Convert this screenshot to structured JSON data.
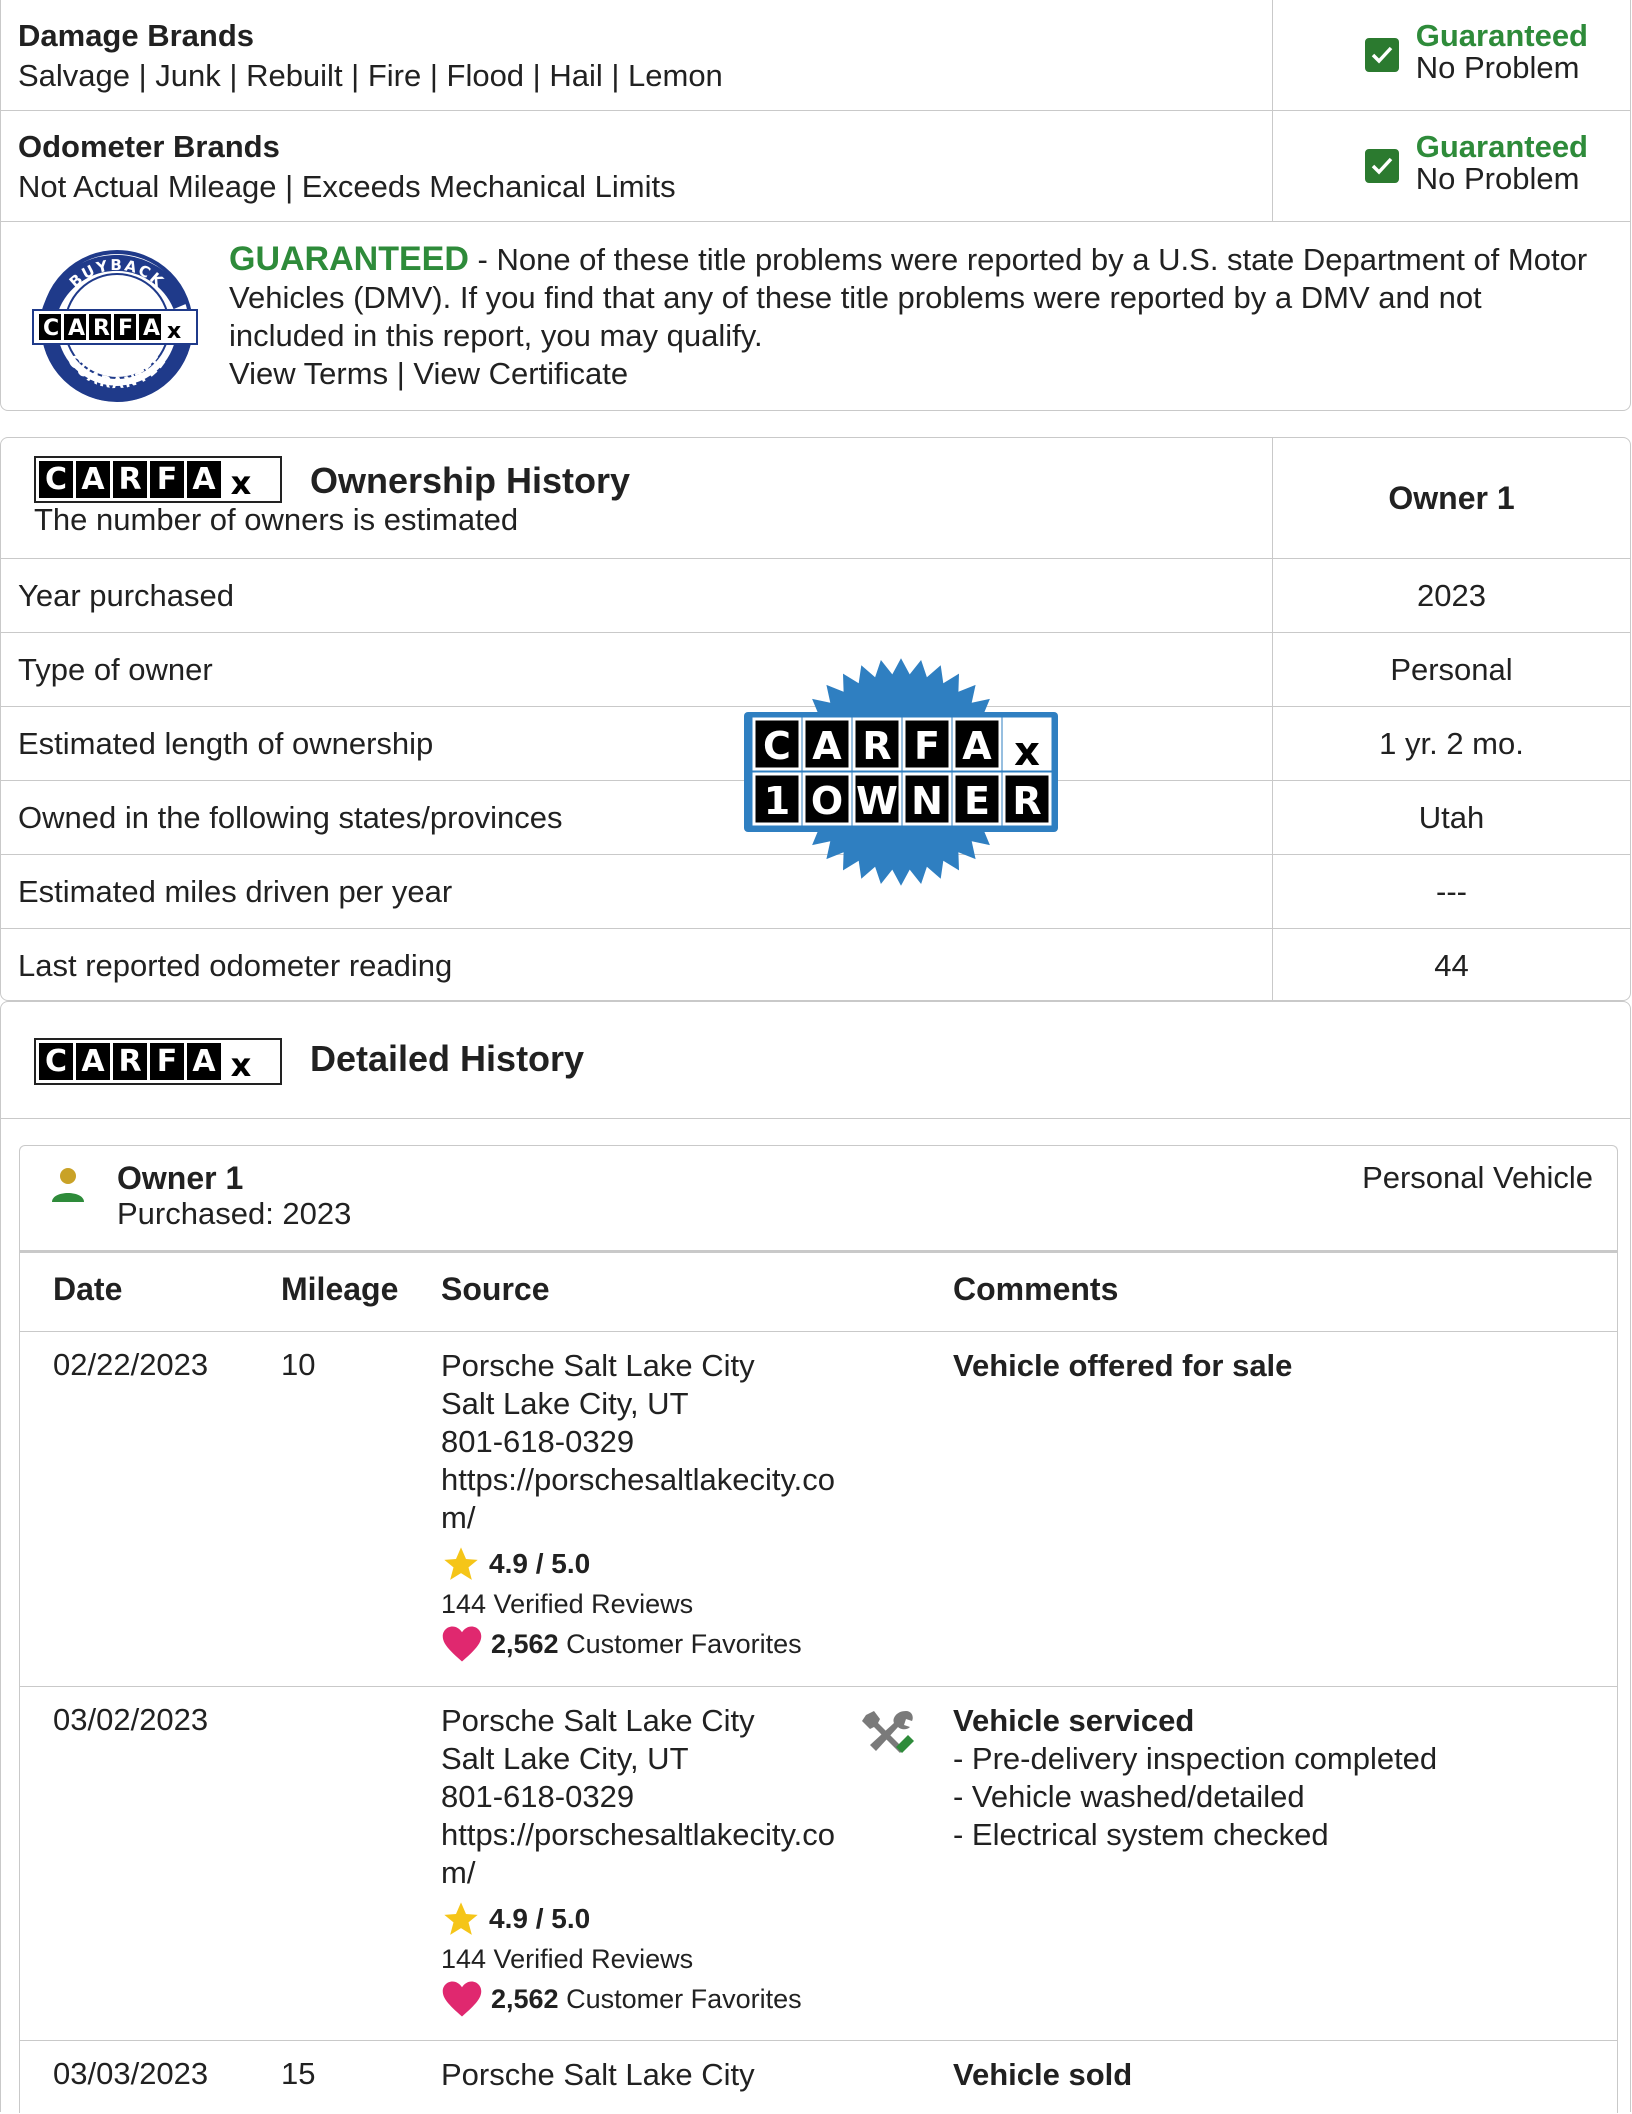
{
  "brands": {
    "rows": [
      {
        "title": "Damage Brands",
        "subtitle": "Salvage | Junk | Rebuilt | Fire | Flood | Hail | Lemon",
        "status_guaranteed": "Guaranteed",
        "status_result": "No Problem"
      },
      {
        "title": "Odometer Brands",
        "subtitle": "Not Actual Mileage | Exceeds Mechanical Limits",
        "status_guaranteed": "Guaranteed",
        "status_result": "No Problem"
      }
    ],
    "guarantee": {
      "word": "GUARANTEED",
      "text": " - None of these title problems were reported by a U.S. state Department of Motor Vehicles (DMV). If you find that any of these title problems were reported by a DMV and not included in this report, you may qualify.",
      "view_terms": "View Terms",
      "divider": " | ",
      "view_certificate": "View Certificate",
      "badge_top": "BUYBACK",
      "badge_bottom": "GUARANTEE"
    }
  },
  "logo_letters": [
    "C",
    "A",
    "R",
    "F",
    "A",
    "x"
  ],
  "ownership": {
    "title": "Ownership History",
    "subtitle": "The number of owners is estimated",
    "owner_header": "Owner 1",
    "rows": [
      {
        "label": "Year purchased",
        "value": "2023"
      },
      {
        "label": "Type of owner",
        "value": "Personal"
      },
      {
        "label": "Estimated length of ownership",
        "value": "1 yr. 2 mo."
      },
      {
        "label": "Owned in the following states/provinces",
        "value": "Utah"
      },
      {
        "label": "Estimated miles driven per year",
        "value": "---"
      },
      {
        "label": "Last reported odometer reading",
        "value": "44"
      }
    ],
    "seal_bottom_letters": [
      "1",
      "O",
      "W",
      "N",
      "E",
      "R"
    ]
  },
  "detailed": {
    "title": "Detailed History",
    "owner": {
      "name": "Owner 1",
      "purchased": "Purchased: 2023",
      "type": "Personal Vehicle"
    },
    "columns": {
      "date": "Date",
      "mileage": "Mileage",
      "source": "Source",
      "comments": "Comments"
    },
    "records": [
      {
        "date": "02/22/2023",
        "mileage": "10",
        "source_name": "Porsche Salt Lake City",
        "source_city": "Salt Lake City, UT",
        "source_phone": "801-618-0329",
        "source_url": "https://porschesaltlakecity.com/",
        "rating": "4.9 / 5.0",
        "reviews": "144 Verified Reviews",
        "favorites_count": "2,562",
        "favorites_label": "Customer Favorites",
        "comment_title": "Vehicle offered for sale",
        "comment_lines": []
      },
      {
        "date": "03/02/2023",
        "mileage": "",
        "source_name": "Porsche Salt Lake City",
        "source_city": "Salt Lake City, UT",
        "source_phone": "801-618-0329",
        "source_url": "https://porschesaltlakecity.com/",
        "rating": "4.9 / 5.0",
        "reviews": "144 Verified Reviews",
        "favorites_count": "2,562",
        "favorites_label": "Customer Favorites",
        "comment_title": "Vehicle serviced",
        "comment_lines": [
          "- Pre-delivery inspection completed",
          "- Vehicle washed/detailed",
          "- Electrical system checked"
        ]
      },
      {
        "date": "03/03/2023",
        "mileage": "15",
        "source_name": "Porsche Salt Lake City",
        "comment_title": "Vehicle sold"
      }
    ]
  },
  "colors": {
    "guaranteed_green": "#2e8b3a",
    "seal_blue": "#2f7fc1",
    "star_yellow": "#f5c518",
    "heart_pink": "#e0286f"
  }
}
